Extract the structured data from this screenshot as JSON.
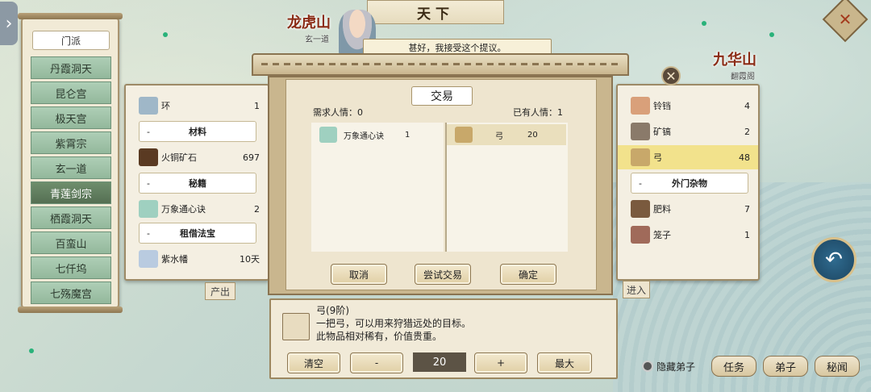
{
  "map": {
    "title": "天下",
    "locations": [
      {
        "name": "龙虎山",
        "sub": "玄一道"
      },
      {
        "name": "九华山",
        "sub": "翻霞阁"
      }
    ],
    "produce_label": "产出",
    "enter_label": "进入"
  },
  "npc": {
    "message": "甚好，我接受这个提议。"
  },
  "sects": {
    "header": "门派",
    "items": [
      "丹霞洞天",
      "昆仑宫",
      "极天宫",
      "紫霄宗",
      "玄一道",
      "青莲剑宗",
      "栖霞洞天",
      "百蛮山",
      "七仟坞",
      "七殇魔宫"
    ],
    "active_index": 5
  },
  "my_inventory": {
    "rows": [
      {
        "type": "item",
        "name": "环",
        "count": "1",
        "icon": "ring-icon",
        "color": "#9fb7c8"
      },
      {
        "type": "category",
        "name": "材料"
      },
      {
        "type": "item",
        "name": "火铜矿石",
        "count": "697",
        "icon": "ore-icon",
        "color": "#5a3a22"
      },
      {
        "type": "category",
        "name": "秘籍"
      },
      {
        "type": "item",
        "name": "万象通心诀",
        "count": "2",
        "icon": "scroll-icon",
        "color": "#9fd0c0"
      },
      {
        "type": "category",
        "name": "租借法宝"
      },
      {
        "type": "item",
        "name": "紫水幡",
        "count": "10天",
        "icon": "banner-icon",
        "color": "#b9cbe0"
      }
    ]
  },
  "their_inventory": {
    "rows": [
      {
        "type": "item",
        "name": "铃铛",
        "count": "4",
        "icon": "bell-icon",
        "color": "#d9a07a"
      },
      {
        "type": "item",
        "name": "矿镐",
        "count": "2",
        "icon": "pickaxe-icon",
        "color": "#8a7a6a"
      },
      {
        "type": "item",
        "name": "弓",
        "count": "48",
        "icon": "bow-icon",
        "color": "#c8a86a",
        "selected": true
      },
      {
        "type": "category",
        "name": "外门杂物"
      },
      {
        "type": "item",
        "name": "肥料",
        "count": "7",
        "icon": "fertilizer-icon",
        "color": "#7a5a3e"
      },
      {
        "type": "item",
        "name": "笼子",
        "count": "1",
        "icon": "cage-icon",
        "color": "#a06a5a"
      }
    ]
  },
  "trade": {
    "title": "交易",
    "required_label": "需求人情：0",
    "owned_label": "已有人情：1",
    "offer": [
      {
        "name": "万象通心诀",
        "count": "1",
        "icon": "scroll-icon",
        "color": "#9fd0c0"
      }
    ],
    "request": [
      {
        "name": "弓",
        "count": "20",
        "icon": "bow-icon",
        "color": "#c8a86a"
      }
    ],
    "buttons": {
      "cancel": "取消",
      "try": "尝试交易",
      "confirm": "确定"
    }
  },
  "detail": {
    "name": "弓(9阶)",
    "desc1": "一把弓，可以用来狩猎远处的目标。",
    "desc2": "此物品相对稀有，价值贵重。",
    "clear": "清空",
    "minus": "-",
    "quantity": "20",
    "plus": "+",
    "max": "最大"
  },
  "hud": {
    "hide_disciples": "隐藏弟子",
    "task": "任务",
    "disciple": "弟子",
    "secret": "秘闻"
  }
}
